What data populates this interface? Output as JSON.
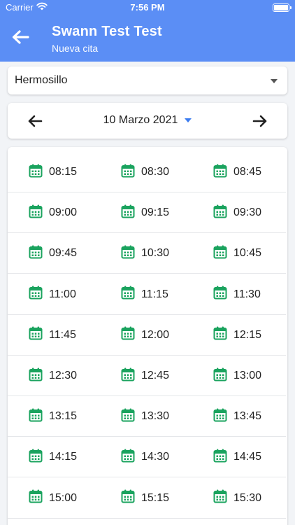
{
  "status": {
    "carrier": "Carrier",
    "time": "7:56 PM",
    "battery_level": 1.0
  },
  "header": {
    "title": "Swann Test Test",
    "subtitle": "Nueva cita"
  },
  "location": {
    "selected": "Hermosillo"
  },
  "date_nav": {
    "date": "10 Marzo 2021"
  },
  "colors": {
    "header": "#5b8ef5",
    "calendar_icon": "#1aa35e",
    "date_caret": "#3b7cf0"
  },
  "slots": [
    [
      "08:15",
      "08:30",
      "08:45"
    ],
    [
      "09:00",
      "09:15",
      "09:30"
    ],
    [
      "09:45",
      "10:30",
      "10:45"
    ],
    [
      "11:00",
      "11:15",
      "11:30"
    ],
    [
      "11:45",
      "12:00",
      "12:15"
    ],
    [
      "12:30",
      "12:45",
      "13:00"
    ],
    [
      "13:15",
      "13:30",
      "13:45"
    ],
    [
      "14:15",
      "14:30",
      "14:45"
    ],
    [
      "15:00",
      "15:15",
      "15:30"
    ]
  ]
}
